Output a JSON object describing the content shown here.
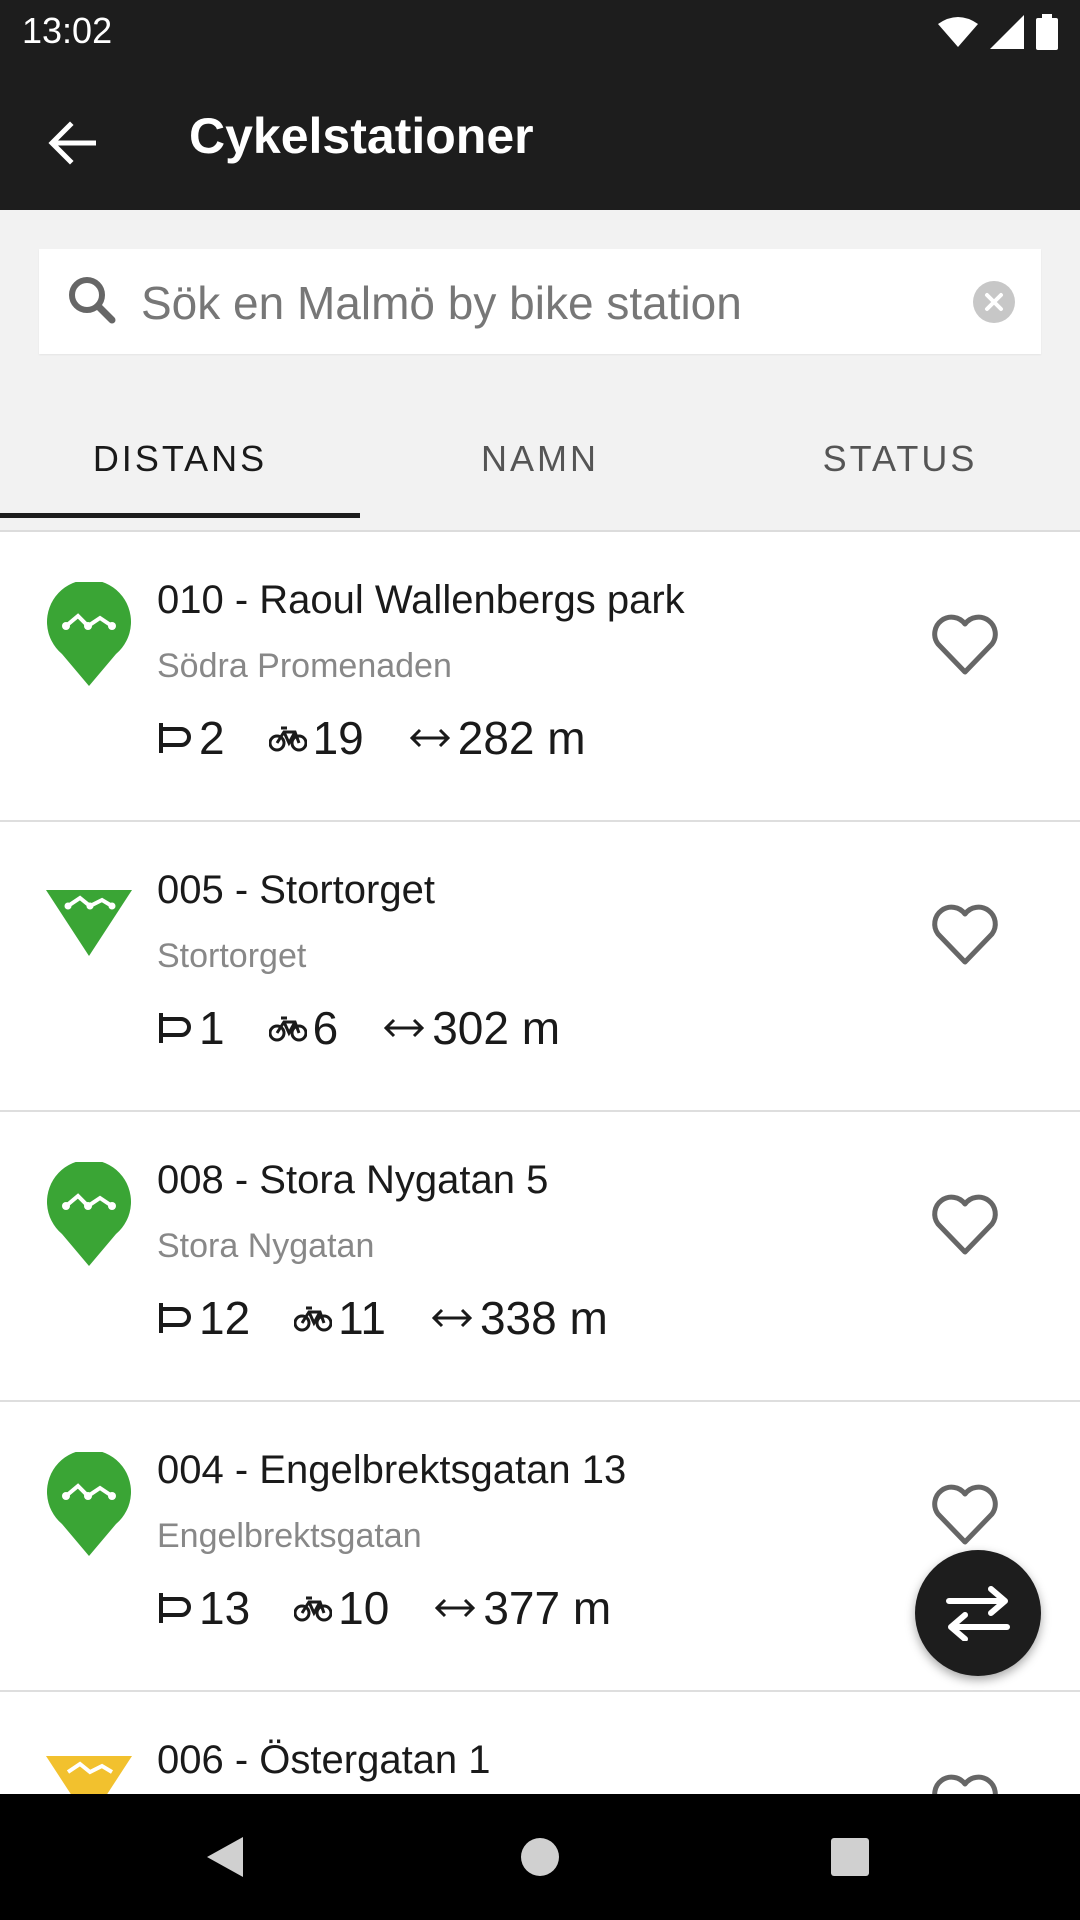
{
  "status_bar": {
    "time": "13:02",
    "icons": [
      "wifi-icon",
      "signal-icon",
      "battery-icon"
    ]
  },
  "app_bar": {
    "title": "Cykelstationer",
    "back_icon": "arrow-left-icon"
  },
  "search": {
    "placeholder": "Sök en Malmö by bike station",
    "value": ""
  },
  "tabs": [
    {
      "label": "DISTANS",
      "active": true
    },
    {
      "label": "NAMN",
      "active": false
    },
    {
      "label": "STATUS",
      "active": false
    }
  ],
  "stations": [
    {
      "name": "010 - Raoul Wallenbergs park",
      "street": "Södra Promenaden",
      "docks": "2",
      "bikes": "19",
      "distance": "282 m",
      "marker": "green-pin",
      "favorite": false
    },
    {
      "name": "005 - Stortorget",
      "street": "Stortorget",
      "docks": "1",
      "bikes": "6",
      "distance": "302 m",
      "marker": "green-triangle",
      "favorite": false
    },
    {
      "name": "008 - Stora Nygatan 5",
      "street": "Stora Nygatan",
      "docks": "12",
      "bikes": "11",
      "distance": "338 m",
      "marker": "green-pin",
      "favorite": false
    },
    {
      "name": "004 - Engelbrektsgatan 13",
      "street": "Engelbrektsgatan",
      "docks": "13",
      "bikes": "10",
      "distance": "377 m",
      "marker": "green-pin",
      "favorite": false
    },
    {
      "name": "006 - Östergatan 1",
      "street": "",
      "docks": "",
      "bikes": "",
      "distance": "",
      "marker": "yellow-triangle",
      "favorite": false
    }
  ],
  "colors": {
    "bar": "#1d1d1d",
    "green": "#3aa535",
    "yellow": "#f2c12e"
  },
  "fab_icon": "swap-arrows-icon",
  "nav": [
    "back-triangle-icon",
    "home-circle-icon",
    "recents-square-icon"
  ]
}
